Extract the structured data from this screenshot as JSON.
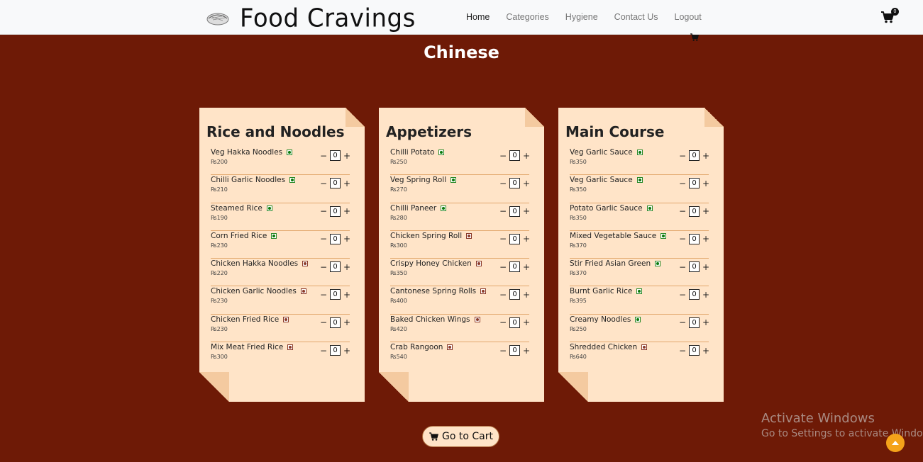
{
  "brand": {
    "name": "Food Cravings",
    "logo_icon": "bowl-icon"
  },
  "nav": {
    "links": [
      "Home",
      "Categories",
      "Hygiene",
      "Contact Us",
      "Logout"
    ],
    "cart_count": "0"
  },
  "page_title": "Chinese",
  "menus": [
    {
      "title": "Rice and Noodles",
      "items": [
        {
          "name": "Veg Hakka Noodles",
          "price": "₨200",
          "veg": true,
          "qty": "0"
        },
        {
          "name": "Chilli Garlic Noodles",
          "price": "₨210",
          "veg": true,
          "qty": "0"
        },
        {
          "name": "Steamed Rice",
          "price": "₨190",
          "veg": true,
          "qty": "0"
        },
        {
          "name": "Corn Fried Rice",
          "price": "₨230",
          "veg": true,
          "qty": "0"
        },
        {
          "name": "Chicken Hakka Noodles",
          "price": "₨220",
          "veg": false,
          "qty": "0"
        },
        {
          "name": "Chicken Garlic Noodles",
          "price": "₨230",
          "veg": false,
          "qty": "0"
        },
        {
          "name": "Chicken Fried Rice",
          "price": "₨230",
          "veg": false,
          "qty": "0"
        },
        {
          "name": "Mix Meat Fried Rice",
          "price": "₨300",
          "veg": false,
          "qty": "0"
        }
      ]
    },
    {
      "title": "Appetizers",
      "items": [
        {
          "name": "Chilli Potato",
          "price": "₨250",
          "veg": true,
          "qty": "0"
        },
        {
          "name": "Veg Spring Roll",
          "price": "₨270",
          "veg": true,
          "qty": "0"
        },
        {
          "name": "Chilli Paneer",
          "price": "₨280",
          "veg": true,
          "qty": "0"
        },
        {
          "name": "Chicken Spring Roll",
          "price": "₨300",
          "veg": false,
          "qty": "0"
        },
        {
          "name": "Crispy Honey Chicken",
          "price": "₨350",
          "veg": false,
          "qty": "0"
        },
        {
          "name": "Cantonese Spring Rolls",
          "price": "₨400",
          "veg": false,
          "qty": "0"
        },
        {
          "name": "Baked Chicken Wings",
          "price": "₨420",
          "veg": false,
          "qty": "0"
        },
        {
          "name": "Crab Rangoon",
          "price": "₨540",
          "veg": false,
          "qty": "0"
        }
      ]
    },
    {
      "title": "Main Course",
      "items": [
        {
          "name": "Veg Garlic Sauce",
          "price": "₨350",
          "veg": true,
          "qty": "0"
        },
        {
          "name": "Veg Garlic Sauce",
          "price": "₨350",
          "veg": true,
          "qty": "0"
        },
        {
          "name": "Potato Garlic Sauce",
          "price": "₨350",
          "veg": true,
          "qty": "0"
        },
        {
          "name": "Mixed Vegetable Sauce",
          "price": "₨370",
          "veg": true,
          "qty": "0"
        },
        {
          "name": "Stir Fried Asian Green",
          "price": "₨370",
          "veg": true,
          "qty": "0"
        },
        {
          "name": "Burnt Garlic Rice",
          "price": "₨395",
          "veg": true,
          "qty": "0"
        },
        {
          "name": "Creamy Noodles",
          "price": "₨250",
          "veg": true,
          "qty": "0"
        },
        {
          "name": "Shredded Chicken",
          "price": "₨640",
          "veg": false,
          "qty": "0"
        }
      ]
    }
  ],
  "stepper": {
    "minus": "−",
    "plus": "+"
  },
  "go_to_cart": "Go to Cart",
  "watermark": {
    "title": "Activate Windows",
    "subtitle": "Go to Settings to activate Windows."
  },
  "colors": {
    "background": "#6e1a06",
    "card": "#ffe4c8",
    "accent": "#f4a21a",
    "veg": "#0a7a0a",
    "nonveg": "#8b3a2a"
  }
}
